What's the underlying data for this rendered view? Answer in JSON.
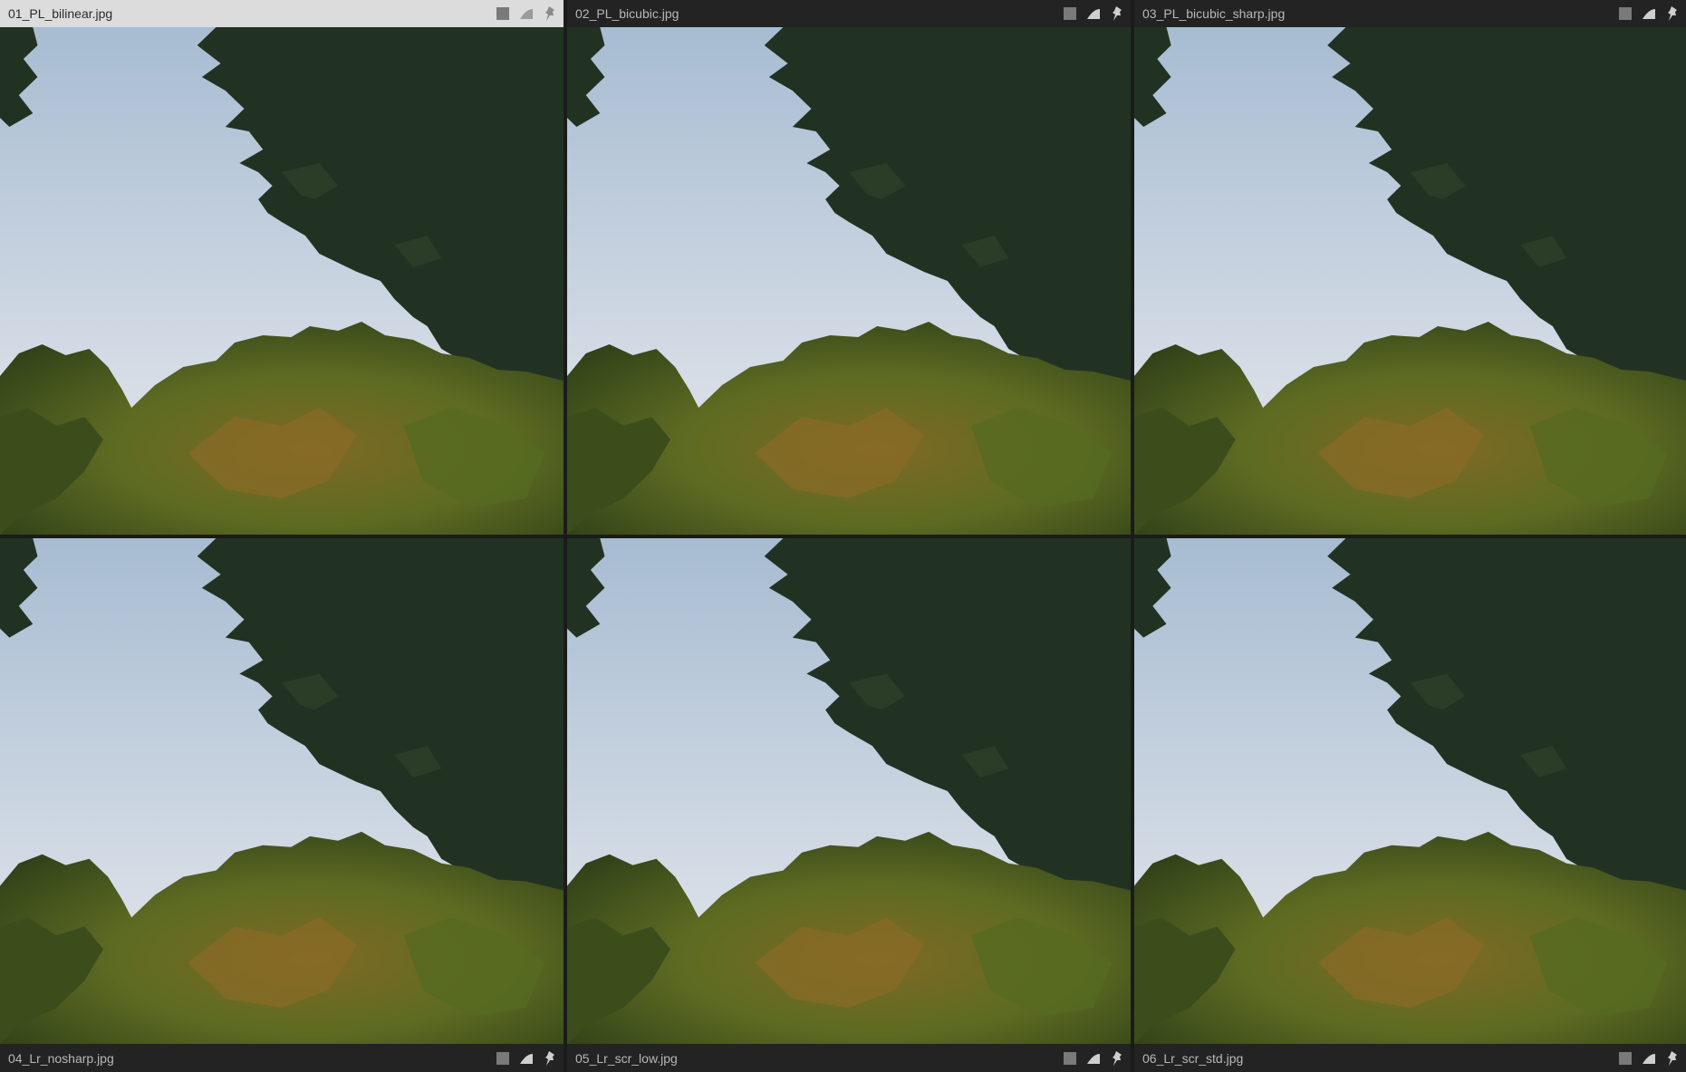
{
  "colors": {
    "sky_top": "#a7bcd2",
    "sky_bottom": "#dde3ea",
    "foliage_dark": "#233322",
    "foliage_mid": "#4d6422",
    "foliage_warm": "#7f6a25",
    "background": "#1b1b1b",
    "active_bar": "#dcdcdc"
  },
  "panels": [
    {
      "filename": "01_PL_bilinear.jpg",
      "active": true,
      "icons": [
        "square-icon",
        "compare-icon",
        "pin-icon"
      ]
    },
    {
      "filename": "02_PL_bicubic.jpg",
      "active": false,
      "icons": [
        "square-icon",
        "compare-icon",
        "pin-icon"
      ]
    },
    {
      "filename": "03_PL_bicubic_sharp.jpg",
      "active": false,
      "icons": [
        "square-icon",
        "compare-icon",
        "pin-icon"
      ]
    },
    {
      "filename": "04_Lr_nosharp.jpg",
      "active": false,
      "icons": [
        "square-icon",
        "compare-icon",
        "pin-icon"
      ]
    },
    {
      "filename": "05_Lr_scr_low.jpg",
      "active": false,
      "icons": [
        "square-icon",
        "compare-icon",
        "pin-icon"
      ]
    },
    {
      "filename": "06_Lr_scr_std.jpg",
      "active": false,
      "icons": [
        "square-icon",
        "compare-icon",
        "pin-icon"
      ]
    }
  ]
}
